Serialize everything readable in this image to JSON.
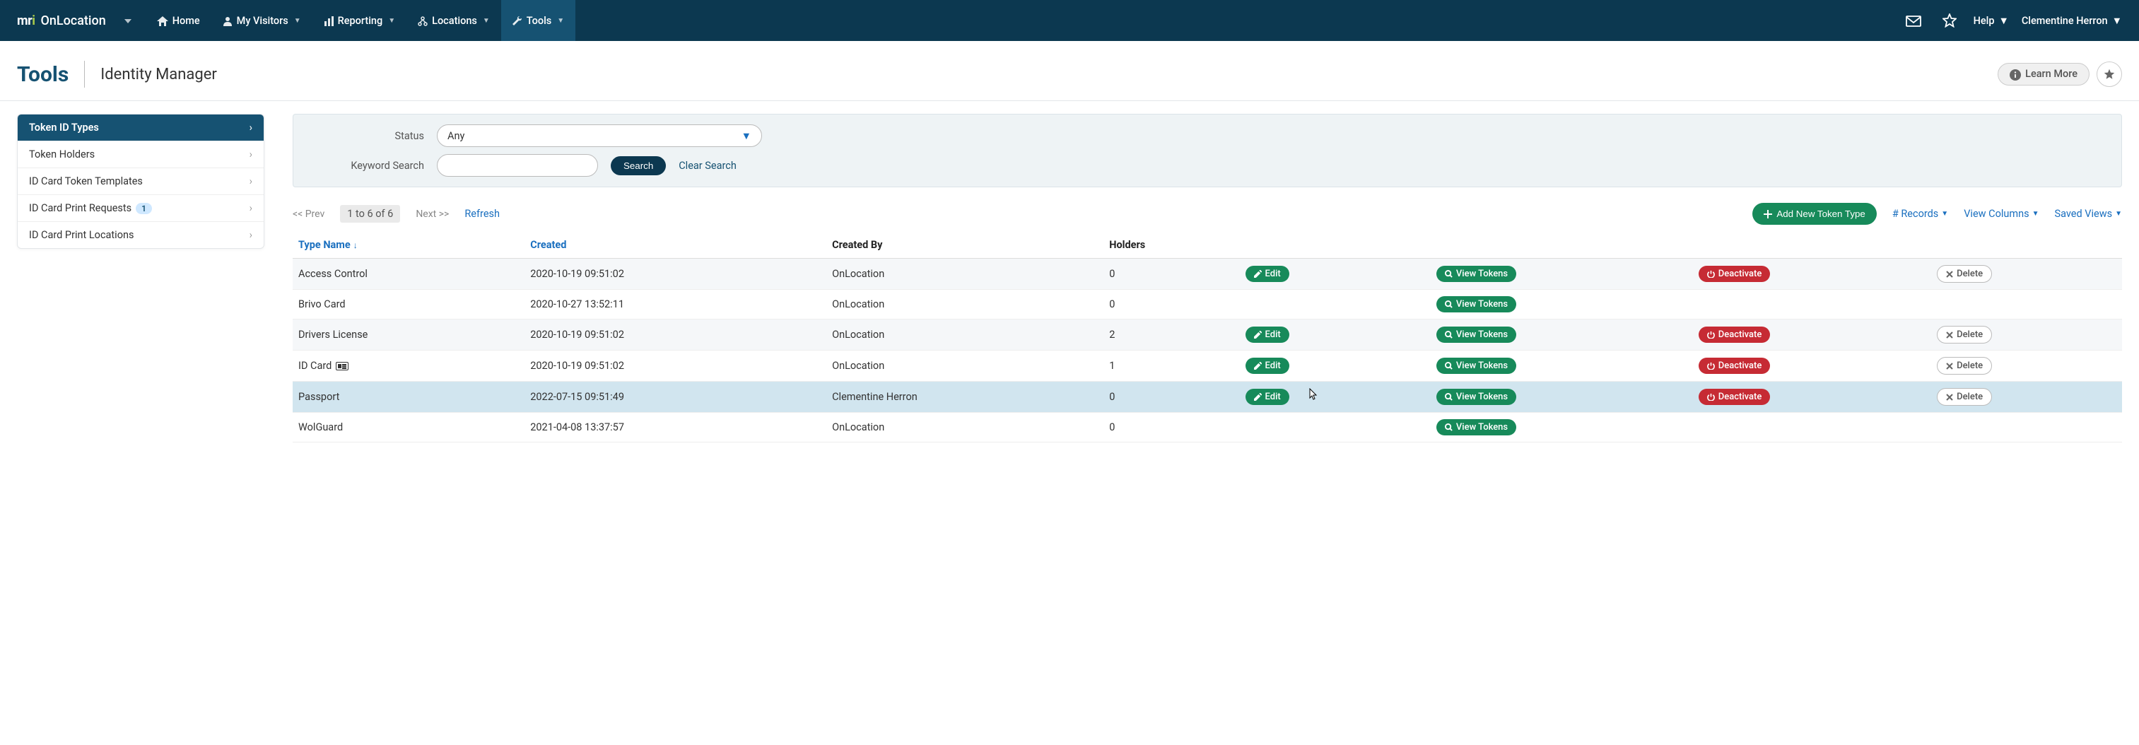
{
  "brand": {
    "logo_1": "mr",
    "logo_2": "i",
    "text": "OnLocation"
  },
  "nav": {
    "home": "Home",
    "visitors": "My Visitors",
    "reporting": "Reporting",
    "locations": "Locations",
    "tools": "Tools",
    "help": "Help",
    "user": "Clementine Herron"
  },
  "header": {
    "title": "Tools",
    "subtitle": "Identity Manager",
    "learn_more": "Learn More"
  },
  "sidebar": {
    "items": [
      {
        "label": "Token ID Types"
      },
      {
        "label": "Token Holders"
      },
      {
        "label": "ID Card Token Templates"
      },
      {
        "label": "ID Card Print Requests",
        "badge": "1"
      },
      {
        "label": "ID Card Print Locations"
      }
    ]
  },
  "filter": {
    "status_label": "Status",
    "status_value": "Any",
    "keyword_label": "Keyword Search",
    "keyword_value": "",
    "search_btn": "Search",
    "clear": "Clear Search"
  },
  "toolbar": {
    "prev": "<< Prev",
    "range": "1 to 6 of 6",
    "next": "Next >>",
    "refresh": "Refresh",
    "add": "Add New Token Type",
    "records": "# Records",
    "columns": "View Columns",
    "saved": "Saved Views"
  },
  "table": {
    "headers": {
      "type": "Type Name",
      "created": "Created",
      "created_by": "Created By",
      "holders": "Holders"
    },
    "actions": {
      "edit": "Edit",
      "view": "View Tokens",
      "deact": "Deactivate",
      "delete": "Delete"
    },
    "rows": [
      {
        "type": "Access Control",
        "created": "2020-10-19 09:51:02",
        "by": "OnLocation",
        "holders": "0",
        "edit": true,
        "deact": true,
        "delete": true,
        "idicon": false
      },
      {
        "type": "Brivo Card",
        "created": "2020-10-27 13:52:11",
        "by": "OnLocation",
        "holders": "0",
        "edit": false,
        "deact": false,
        "delete": false,
        "idicon": false
      },
      {
        "type": "Drivers License",
        "created": "2020-10-19 09:51:02",
        "by": "OnLocation",
        "holders": "2",
        "edit": true,
        "deact": true,
        "delete": true,
        "idicon": false
      },
      {
        "type": "ID Card",
        "created": "2020-10-19 09:51:02",
        "by": "OnLocation",
        "holders": "1",
        "edit": true,
        "deact": true,
        "delete": true,
        "idicon": true
      },
      {
        "type": "Passport",
        "created": "2022-07-15 09:51:49",
        "by": "Clementine Herron",
        "holders": "0",
        "edit": true,
        "deact": true,
        "delete": true,
        "idicon": false
      },
      {
        "type": "WolGuard",
        "created": "2021-04-08 13:37:57",
        "by": "OnLocation",
        "holders": "0",
        "edit": false,
        "deact": false,
        "delete": false,
        "idicon": false
      }
    ]
  }
}
